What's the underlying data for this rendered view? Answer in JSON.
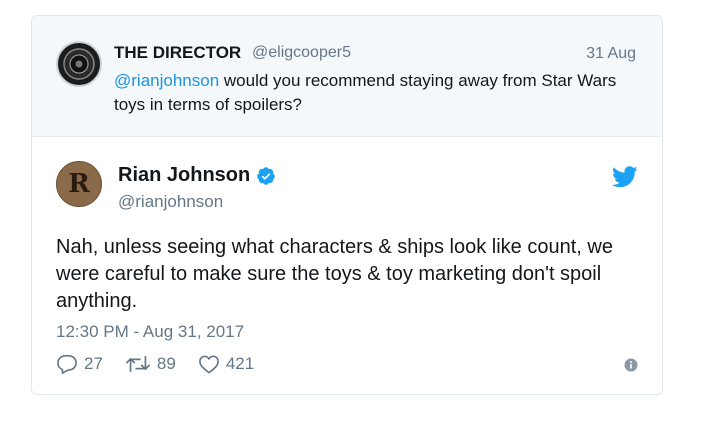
{
  "quoted": {
    "name": "THE DIRECTOR",
    "handle": "@eligcooper5",
    "date": "31 Aug",
    "mention": "@rianjohnson",
    "text": " would you recommend staying away from Star Wars toys in terms of spoilers?"
  },
  "tweet": {
    "avatar_letter": "R",
    "name": "Rian Johnson",
    "handle": "@rianjohnson",
    "text": "Nah, unless seeing what characters & ships look like count, we were careful to make sure the toys & toy marketing don't spoil anything.",
    "timestamp": "12:30 PM - Aug 31, 2017"
  },
  "actions": {
    "replies": "27",
    "retweets": "89",
    "likes": "421"
  },
  "colors": {
    "accent": "#1da1f2",
    "link": "#1b95e0",
    "muted": "#657786"
  },
  "icons": [
    "verified-badge-icon",
    "twitter-bird-icon",
    "reply-icon",
    "retweet-icon",
    "like-icon",
    "info-icon"
  ]
}
